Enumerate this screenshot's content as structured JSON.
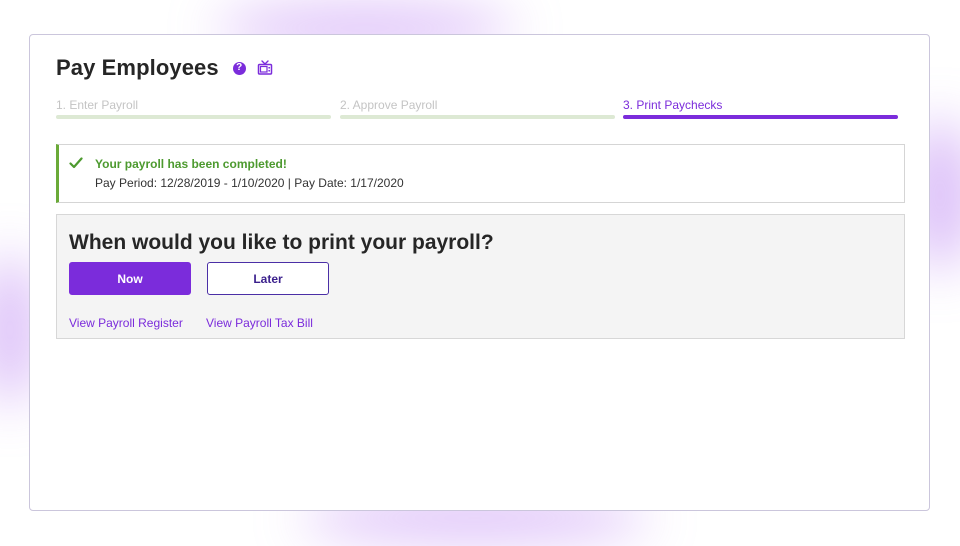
{
  "page": {
    "title": "Pay Employees",
    "help_icon": "question-circle-icon",
    "help_glyph": "?",
    "video_icon": "tv-icon"
  },
  "stepper": {
    "steps": [
      {
        "label": "1. Enter Payroll",
        "state": "complete"
      },
      {
        "label": "2. Approve Payroll",
        "state": "complete"
      },
      {
        "label": "3. Print Paychecks",
        "state": "active"
      }
    ]
  },
  "status": {
    "icon": "checkmark-icon",
    "title": "Your payroll has been completed!",
    "details": "Pay Period: 12/28/2019 - 1/10/2020 | Pay Date: 1/17/2020"
  },
  "print": {
    "question": "When would you like to print your payroll?",
    "now_label": "Now",
    "later_label": "Later",
    "links": {
      "register": "View Payroll Register",
      "tax_bill": "View Payroll Tax Bill"
    }
  },
  "colors": {
    "accent": "#7b2cdb",
    "success": "#4d9a2f",
    "step_complete": "#dde9d4"
  }
}
